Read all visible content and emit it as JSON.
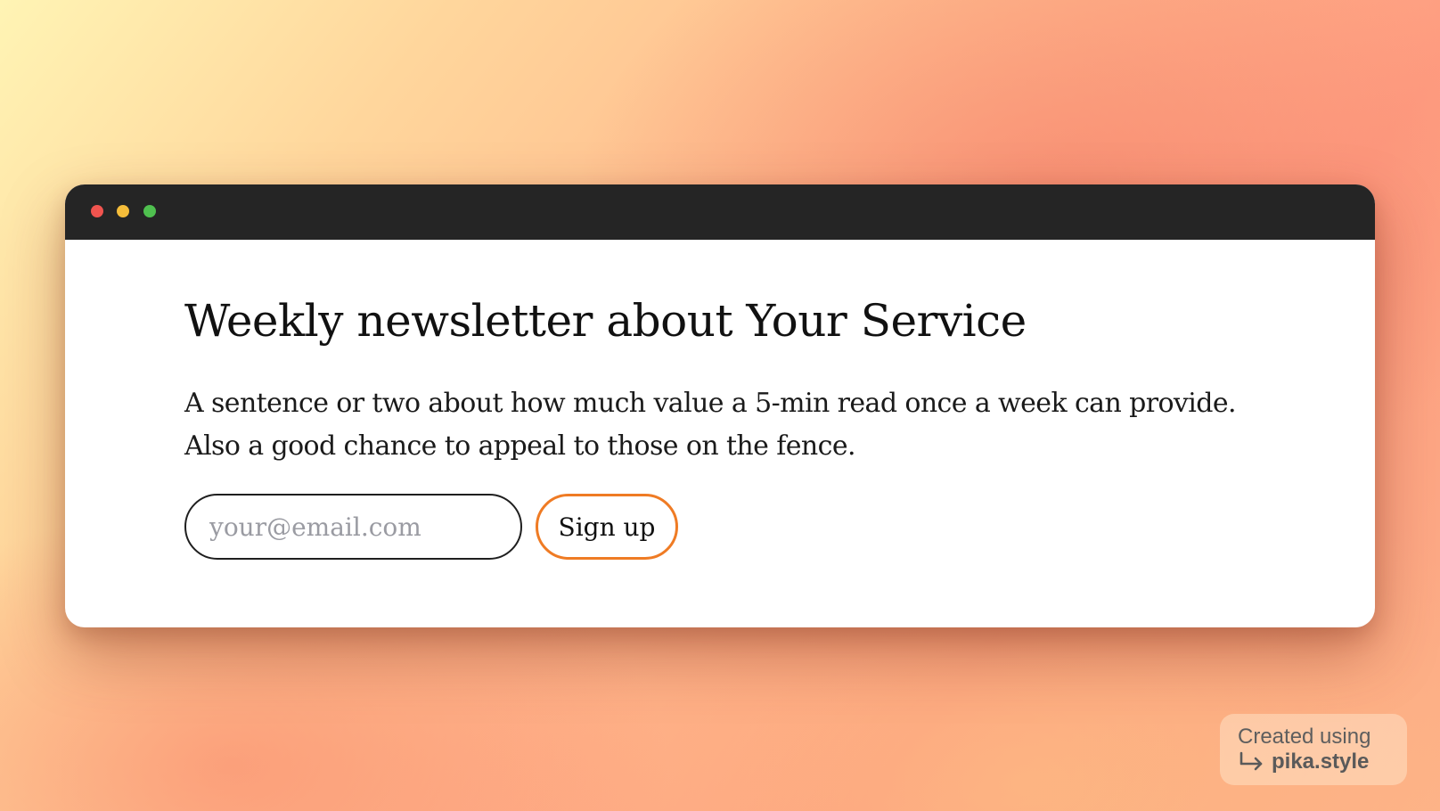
{
  "window": {
    "controls": [
      "close",
      "minimize",
      "maximize"
    ]
  },
  "newsletter": {
    "title": "Weekly newsletter about Your Service",
    "description_lines": [
      "A sentence or two about how much value a 5-min read once a week can provide.",
      "Also a good chance to appeal to those on the fence."
    ],
    "email_placeholder": "your@email.com",
    "email_value": "",
    "signup_label": "Sign up"
  },
  "watermark": {
    "line1": "Created using",
    "brand": "pika.style",
    "icon": "return-arrow-icon"
  },
  "colors": {
    "titlebar": "#252525",
    "close_dot": "#f0544f",
    "minimize_dot": "#f5bd3a",
    "maximize_dot": "#4fc04f",
    "button_border": "#ef7b24",
    "input_border": "#1f1f1f"
  }
}
